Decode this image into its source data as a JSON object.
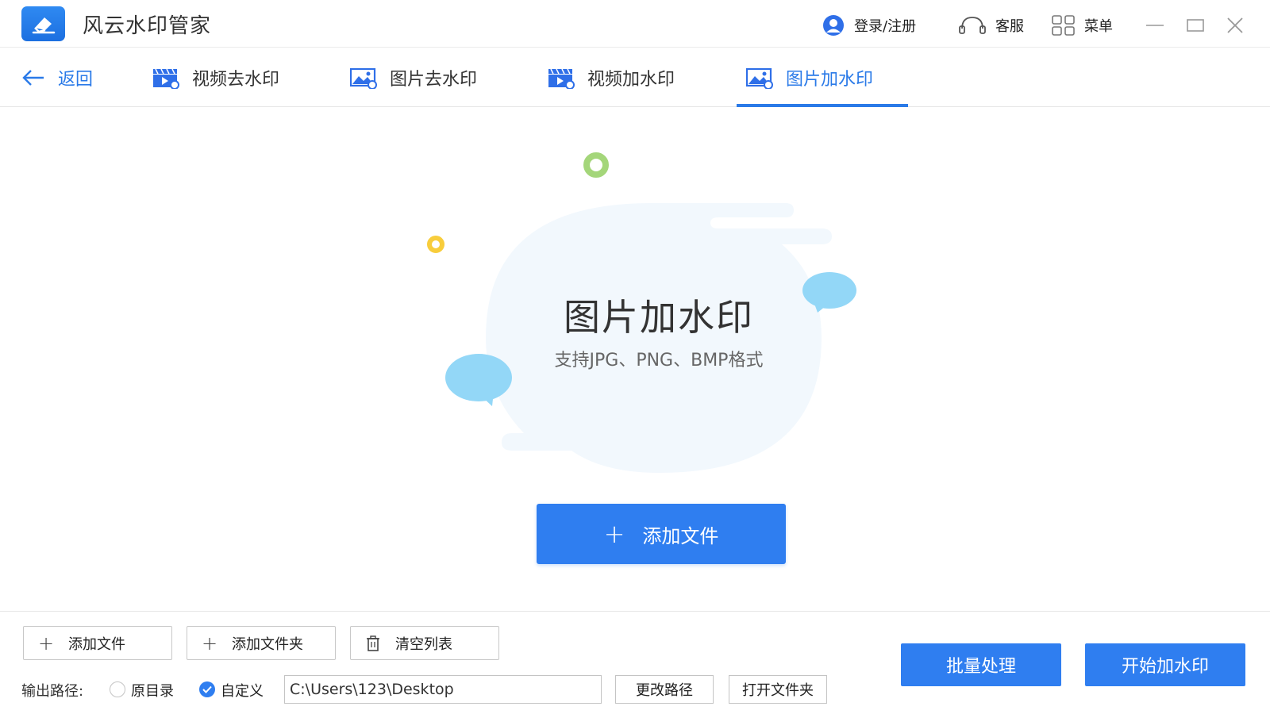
{
  "app": {
    "title": "风云水印管家",
    "logo_icon": "eraser-icon",
    "accent": "#2f7ef0"
  },
  "titlebar": {
    "login_label": "登录/注册",
    "service_label": "客服",
    "menu_label": "菜单"
  },
  "tabs": {
    "back_label": "返回",
    "items": [
      {
        "label": "视频去水印",
        "icon": "video-clapper-icon"
      },
      {
        "label": "图片去水印",
        "icon": "image-icon"
      },
      {
        "label": "视频加水印",
        "icon": "video-clapper-icon"
      },
      {
        "label": "图片加水印",
        "icon": "image-icon",
        "active": true
      }
    ]
  },
  "main": {
    "title": "图片加水印",
    "subtitle": "支持JPG、PNG、BMP格式",
    "add_file_label": "添加文件"
  },
  "bottom": {
    "add_file_label": "添加文件",
    "add_folder_label": "添加文件夹",
    "clear_list_label": "清空列表",
    "output_label": "输出路径:",
    "option_original": "原目录",
    "option_custom": "自定义",
    "selected_option": "自定义",
    "path_value": "C:\\Users\\123\\Desktop",
    "change_path_label": "更改路径",
    "open_folder_label": "打开文件夹",
    "batch_label": "批量处理",
    "start_label": "开始加水印"
  }
}
